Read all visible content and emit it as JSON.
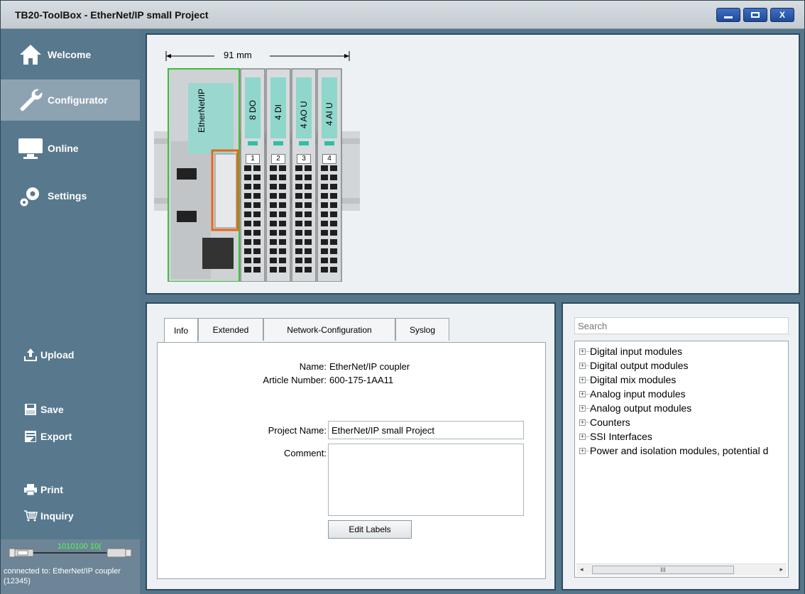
{
  "window": {
    "title": "TB20-ToolBox - EtherNet/IP small Project",
    "buttons": {
      "minimize": "_",
      "maximize": "□",
      "close": "X"
    }
  },
  "sidebar": {
    "nav": [
      {
        "label": "Welcome",
        "icon": "home-icon"
      },
      {
        "label": "Configurator",
        "icon": "wrench-icon",
        "active": true
      },
      {
        "label": "Online",
        "icon": "monitor-icon"
      },
      {
        "label": "Settings",
        "icon": "gears-icon"
      }
    ],
    "actions": {
      "upload": "Upload",
      "save": "Save",
      "export": "Export",
      "print": "Print",
      "inquiry": "Inquiry"
    },
    "status": {
      "usb_text": "1010100 10(",
      "connection": "connected to: EtherNet/IP coupler (12345)"
    }
  },
  "hardware": {
    "dimension": "91 mm",
    "coupler_label": "EtherNet/IP",
    "modules": [
      {
        "label": "8 DO",
        "slot": "1"
      },
      {
        "label": "4 DI",
        "slot": "2"
      },
      {
        "label": "4 AO U",
        "slot": "3"
      },
      {
        "label": "4 AI U",
        "slot": "4"
      }
    ]
  },
  "tabs": [
    "Info",
    "Extended",
    "Network-Configuration",
    "Syslog"
  ],
  "info": {
    "name_label": "Name:",
    "name_value": "EtherNet/IP coupler",
    "article_label": "Article Number:",
    "article_value": "600-175-1AA11",
    "project_label": "Project Name:",
    "project_value": "EtherNet/IP small Project",
    "comment_label": "Comment:",
    "comment_value": "",
    "edit_labels_button": "Edit Labels"
  },
  "catalog": {
    "search_placeholder": "Search",
    "items": [
      "Digital input modules",
      "Digital output modules",
      "Digital mix modules",
      "Analog input modules",
      "Analog output modules",
      "Counters",
      "SSI Interfaces",
      "Power and isolation modules, potential d"
    ],
    "scroll_thumb": "III"
  },
  "colors": {
    "sidebar": "#58788d",
    "active_nav": "#8ea3b2",
    "panel_bg": "#eef1f4",
    "module_green": "#8fd6cc",
    "selection_orange": "#e8661c",
    "coupler_outline": "#3cbf3c"
  }
}
